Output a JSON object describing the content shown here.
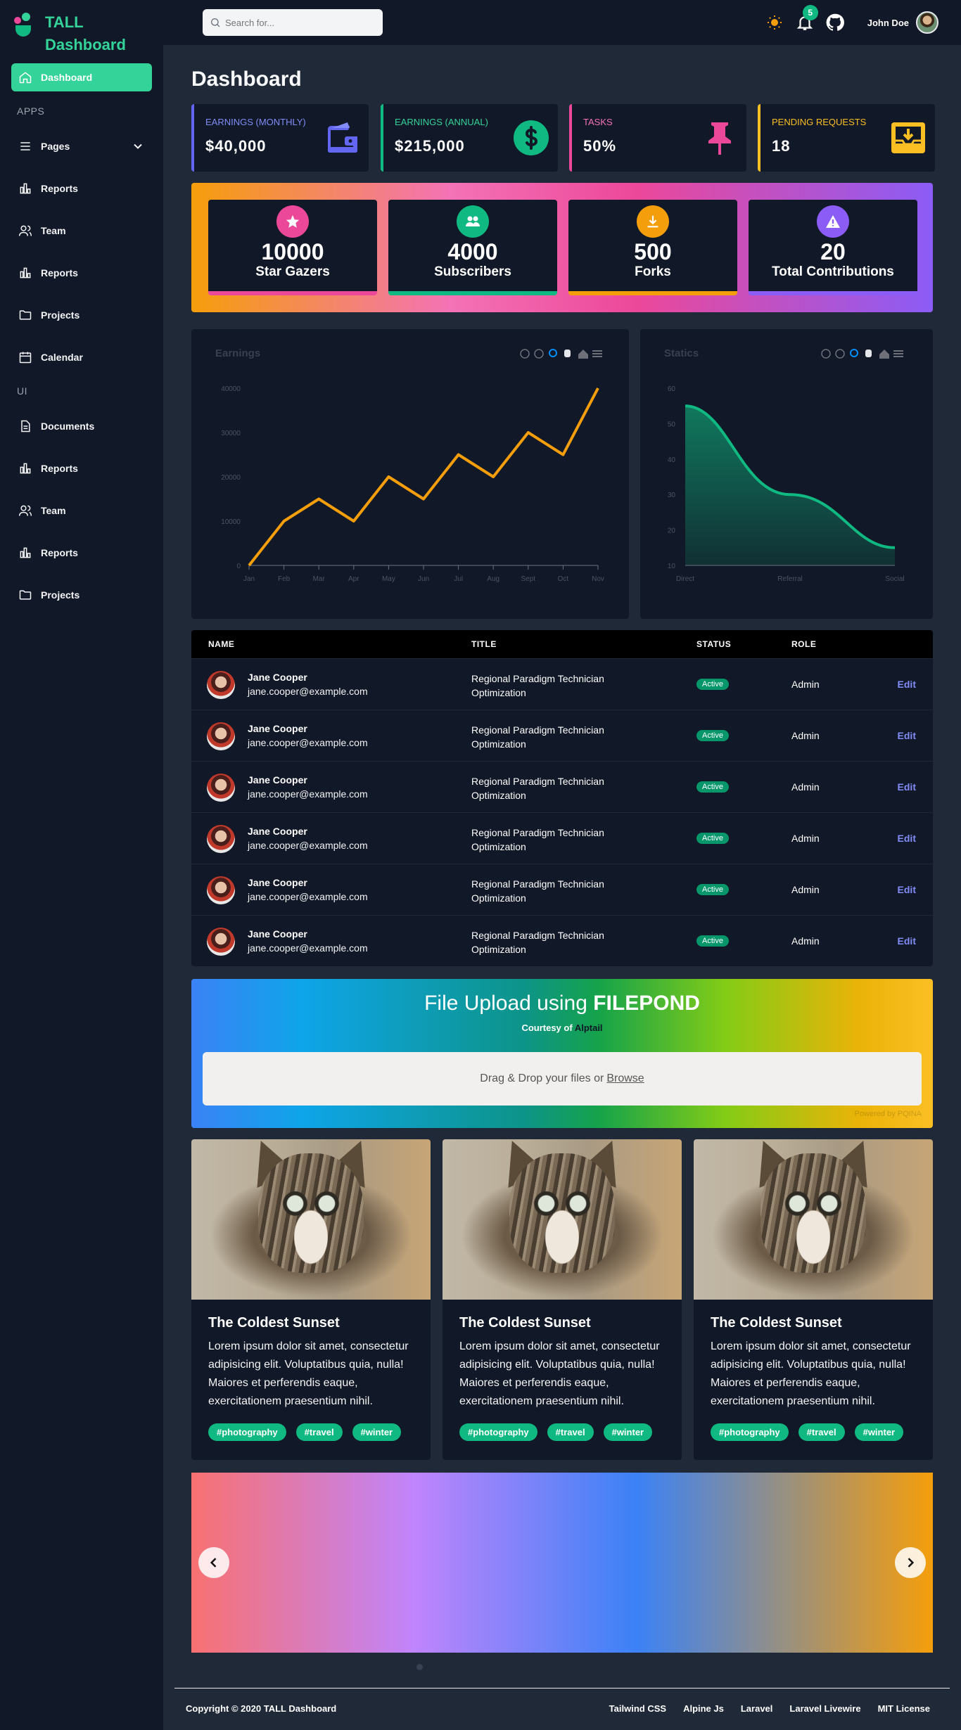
{
  "brand": {
    "line1": "TALL",
    "line2": "Dashboard",
    "color": "#34d399"
  },
  "sidebar": {
    "active": {
      "label": "Dashboard",
      "icon": "home-icon"
    },
    "section_apps": "APPS",
    "apps": [
      {
        "label": "Pages",
        "icon": "menu-icon",
        "expandable": true
      },
      {
        "label": "Reports",
        "icon": "bar-chart-icon"
      },
      {
        "label": "Team",
        "icon": "users-icon"
      },
      {
        "label": "Reports",
        "icon": "bar-chart-icon"
      },
      {
        "label": "Projects",
        "icon": "folder-icon"
      },
      {
        "label": "Calendar",
        "icon": "calendar-icon"
      }
    ],
    "section_ui": "UI",
    "ui": [
      {
        "label": "Documents",
        "icon": "document-icon"
      },
      {
        "label": "Reports",
        "icon": "bar-chart-icon"
      },
      {
        "label": "Team",
        "icon": "users-icon"
      },
      {
        "label": "Reports",
        "icon": "bar-chart-icon"
      },
      {
        "label": "Projects",
        "icon": "folder-icon"
      }
    ]
  },
  "topbar": {
    "search_placeholder": "Search for...",
    "notification_count": "5",
    "username": "John Doe"
  },
  "page_title": "Dashboard",
  "stats": [
    {
      "label": "EARNINGS (MONTHLY)",
      "value": "$40,000",
      "color": "#6366f1",
      "icon": "wallet-icon"
    },
    {
      "label": "EARNINGS (ANNUAL)",
      "value": "$215,000",
      "color": "#10b981",
      "icon": "dollar-icon"
    },
    {
      "label": "TASKS",
      "value": "50%",
      "color": "#ec4899",
      "icon": "pin-icon"
    },
    {
      "label": "PENDING REQUESTS",
      "value": "18",
      "color": "#fbbf24",
      "icon": "inbox-icon"
    }
  ],
  "github_stats": [
    {
      "value": "10000",
      "label": "Star Gazers",
      "color": "#ec4899",
      "icon": "star-icon"
    },
    {
      "value": "4000",
      "label": "Subscribers",
      "color": "#10b981",
      "icon": "users-icon"
    },
    {
      "value": "500",
      "label": "Forks",
      "color": "#f59e0b",
      "icon": "download-icon"
    },
    {
      "value": "20",
      "label": "Total Contributions",
      "color": "#8b5cf6",
      "icon": "warning-icon"
    }
  ],
  "chart_data": [
    {
      "type": "line",
      "title": "Earnings",
      "categories": [
        "Jan",
        "Feb",
        "Mar",
        "Apr",
        "May",
        "Jun",
        "Jul",
        "Aug",
        "Sept",
        "Oct",
        "Nov"
      ],
      "series": [
        {
          "values": [
            0,
            10000,
            15000,
            10000,
            20000,
            15000,
            25000,
            20000,
            30000,
            25000,
            40000
          ]
        }
      ],
      "yticks": [
        0,
        10000,
        20000,
        30000,
        40000
      ],
      "ylim": [
        0,
        40000
      ],
      "color": "#f59e0b"
    },
    {
      "type": "area",
      "title": "Statics",
      "categories": [
        "Direct",
        "Referral",
        "Social"
      ],
      "series": [
        {
          "values": [
            55,
            30,
            15
          ]
        }
      ],
      "yticks": [
        10,
        20,
        30,
        40,
        50,
        60
      ],
      "ylim": [
        10,
        60
      ],
      "color": "#10b981"
    }
  ],
  "table": {
    "headers": {
      "name": "NAME",
      "title": "TITLE",
      "status": "STATUS",
      "role": "ROLE"
    },
    "rows": [
      {
        "name": "Jane Cooper",
        "email": "jane.cooper@example.com",
        "title": "Regional Paradigm Technician Optimization",
        "status": "Active",
        "role": "Admin",
        "action": "Edit"
      },
      {
        "name": "Jane Cooper",
        "email": "jane.cooper@example.com",
        "title": "Regional Paradigm Technician Optimization",
        "status": "Active",
        "role": "Admin",
        "action": "Edit"
      },
      {
        "name": "Jane Cooper",
        "email": "jane.cooper@example.com",
        "title": "Regional Paradigm Technician Optimization",
        "status": "Active",
        "role": "Admin",
        "action": "Edit"
      },
      {
        "name": "Jane Cooper",
        "email": "jane.cooper@example.com",
        "title": "Regional Paradigm Technician Optimization",
        "status": "Active",
        "role": "Admin",
        "action": "Edit"
      },
      {
        "name": "Jane Cooper",
        "email": "jane.cooper@example.com",
        "title": "Regional Paradigm Technician Optimization",
        "status": "Active",
        "role": "Admin",
        "action": "Edit"
      },
      {
        "name": "Jane Cooper",
        "email": "jane.cooper@example.com",
        "title": "Regional Paradigm Technician Optimization",
        "status": "Active",
        "role": "Admin",
        "action": "Edit"
      }
    ]
  },
  "upload": {
    "title_prefix": "File Upload using",
    "title_strong": "FILEPOND",
    "courtesy_prefix": "Courtesy of",
    "courtesy_name": "Alptail",
    "drop_text": "Drag & Drop your files or",
    "browse": "Browse",
    "powered": "Powered by PQINA"
  },
  "cards": [
    {
      "title": "The Coldest Sunset",
      "text": "Lorem ipsum dolor sit amet, consectetur adipisicing elit. Voluptatibus quia, nulla! Maiores et perferendis eaque, exercitationem praesentium nihil.",
      "tags": [
        "#photography",
        "#travel",
        "#winter"
      ]
    },
    {
      "title": "The Coldest Sunset",
      "text": "Lorem ipsum dolor sit amet, consectetur adipisicing elit. Voluptatibus quia, nulla! Maiores et perferendis eaque, exercitationem praesentium nihil.",
      "tags": [
        "#photography",
        "#travel",
        "#winter"
      ]
    },
    {
      "title": "The Coldest Sunset",
      "text": "Lorem ipsum dolor sit amet, consectetur adipisicing elit. Voluptatibus quia, nulla! Maiores et perferendis eaque, exercitationem praesentium nihil.",
      "tags": [
        "#photography",
        "#travel",
        "#winter"
      ]
    }
  ],
  "footer": {
    "copyright": "Copyright © 2020 TALL Dashboard",
    "links": [
      "Tailwind CSS",
      "Alpine Js",
      "Laravel",
      "Laravel Livewire",
      "MIT License"
    ]
  }
}
